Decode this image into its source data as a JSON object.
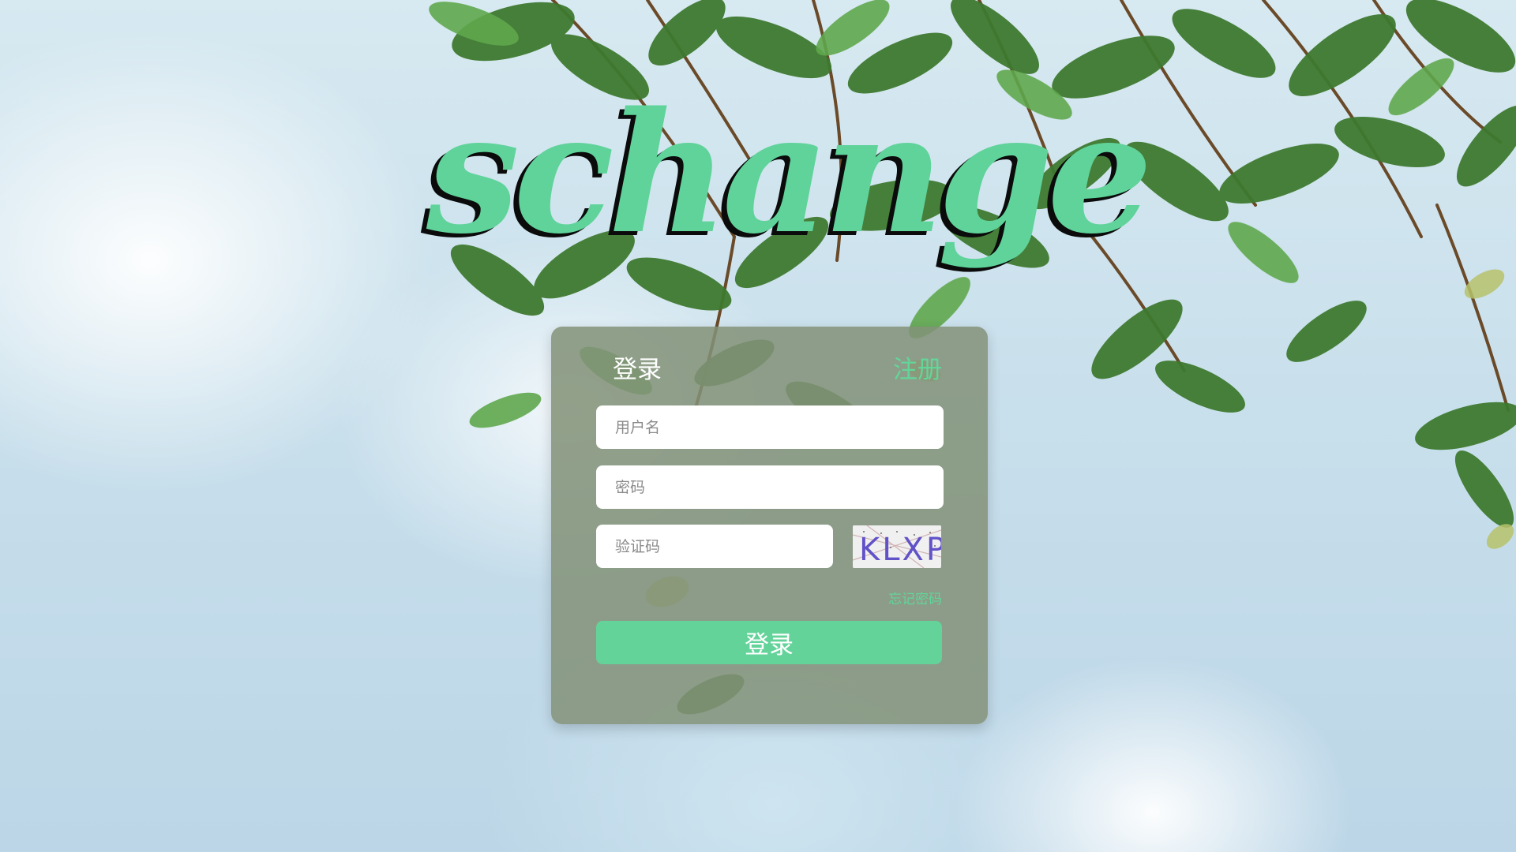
{
  "brand": {
    "title": "schange"
  },
  "login_card": {
    "tab_login_label": "登录",
    "tab_register_label": "注册",
    "username_placeholder": "用户名",
    "password_placeholder": "密码",
    "captcha_placeholder": "验证码",
    "captcha_image_text": "KLXP",
    "forgot_password_label": "忘记密码",
    "submit_label": "登录"
  }
}
